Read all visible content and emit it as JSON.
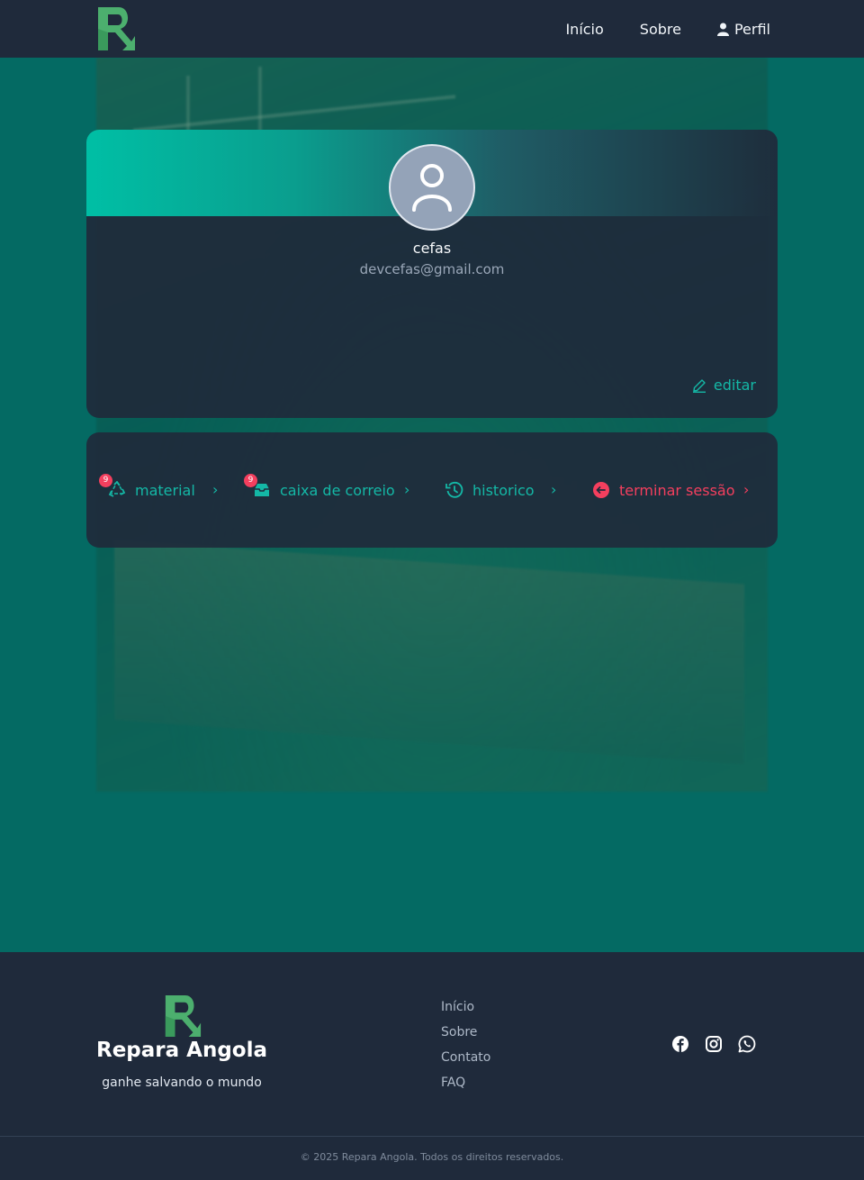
{
  "navbar": {
    "links": [
      {
        "label": "Início"
      },
      {
        "label": "Sobre"
      },
      {
        "label": "Perfil",
        "icon": "user-icon"
      }
    ]
  },
  "profile": {
    "username": "cefas",
    "email": "devcefas@gmail.com",
    "avatar_icon": "user-avatar-icon",
    "edit_label": "editar",
    "edit_icon": "pencil-icon"
  },
  "menu": {
    "items": [
      {
        "label": "material",
        "icon": "recycle-icon",
        "badge": "9",
        "color": "#14b8a6"
      },
      {
        "label": "caixa de correio",
        "icon": "inbox-icon",
        "badge": "9",
        "color": "#14b8a6"
      },
      {
        "label": "historico",
        "icon": "history-icon",
        "color": "#14b8a6"
      },
      {
        "label": "terminar sessão",
        "icon": "logout-icon",
        "color": "#f43f5e"
      }
    ],
    "chevron": "›"
  },
  "footer": {
    "brand": "Repara Angola",
    "tagline": "ganhe salvando o mundo",
    "links": [
      {
        "label": "Início"
      },
      {
        "label": "Sobre"
      },
      {
        "label": "Contato"
      },
      {
        "label": "FAQ"
      }
    ],
    "social": [
      "facebook-icon",
      "instagram-icon",
      "whatsapp-icon"
    ],
    "copyright": "© 2025 Repara Angola. Todos os direitos reservados."
  },
  "colors": {
    "navbar_bg": "#1f2a3b",
    "main_bg": "#046a63",
    "accent": "#14b8a6",
    "danger": "#f43f5e",
    "logo_green": "#4caf6e"
  }
}
